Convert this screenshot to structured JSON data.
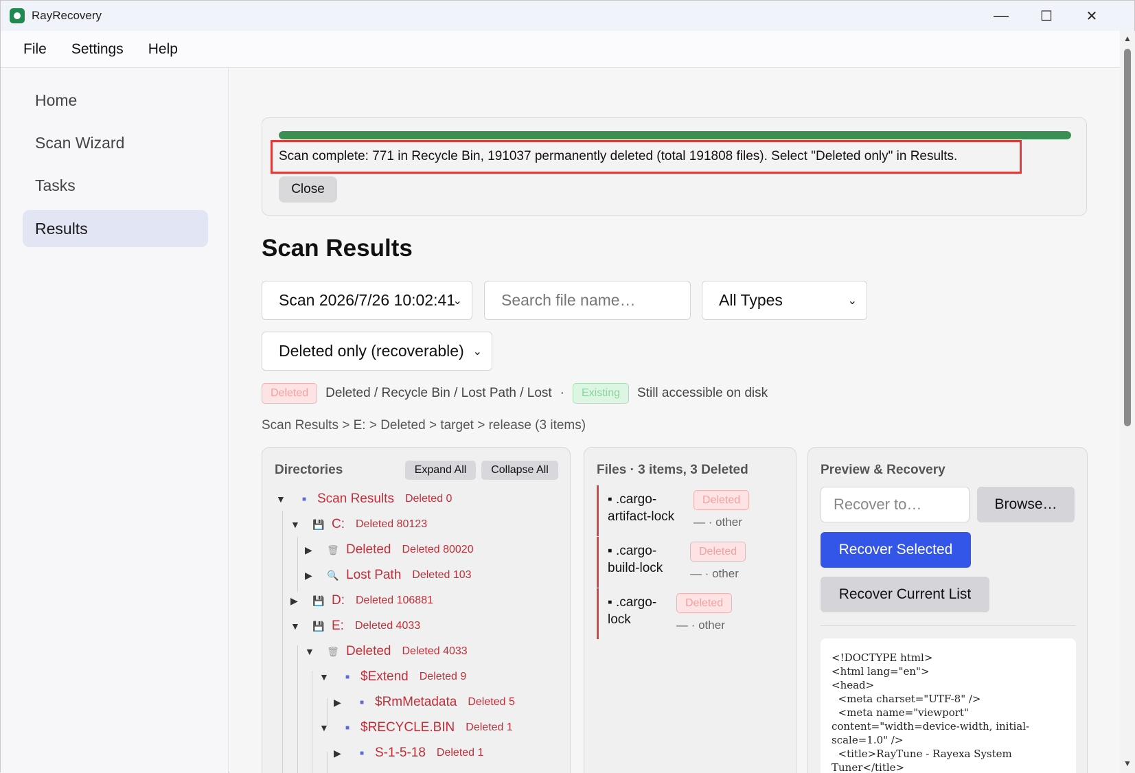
{
  "app": {
    "title": "RayRecovery"
  },
  "window_controls": {
    "minimize": "—",
    "maximize": "☐",
    "close": "✕"
  },
  "menu": [
    "File",
    "Settings",
    "Help"
  ],
  "sidebar": {
    "items": [
      {
        "label": "Home",
        "active": false
      },
      {
        "label": "Scan Wizard",
        "active": false
      },
      {
        "label": "Tasks",
        "active": false
      },
      {
        "label": "Results",
        "active": true
      }
    ]
  },
  "progress": {
    "value_percent": 100,
    "status": "Scan complete: 771 in Recycle Bin, 191037 permanently deleted (total 191808 files). Select \"Deleted only\" in Results.",
    "close_label": "Close"
  },
  "page_title": "Scan Results",
  "filters": {
    "scan_select": "Scan 2026/7/26 10:02:41",
    "search_placeholder": "Search file name…",
    "type_select": "All Types",
    "deleted_select": "Deleted only (recoverable)"
  },
  "legend": {
    "deleted_badge": "Deleted",
    "deleted_desc": "Deleted / Recycle Bin / Lost Path / Lost",
    "separator": "·",
    "existing_badge": "Existing",
    "existing_desc": "Still accessible on disk"
  },
  "breadcrumb": "Scan Results > E: > Deleted > target > release  (3 items)",
  "directories": {
    "title": "Directories",
    "expand_all": "Expand All",
    "collapse_all": "Collapse All",
    "tree": [
      {
        "twisty": "▼",
        "icon": "dot",
        "name": "Scan Results",
        "count": "Deleted 0"
      },
      {
        "twisty": "▼",
        "icon": "drive",
        "name": "C:",
        "count": "Deleted 80123"
      },
      {
        "twisty": "▶",
        "icon": "bin",
        "name": "Deleted",
        "count": "Deleted 80020"
      },
      {
        "twisty": "▶",
        "icon": "lens",
        "name": "Lost Path",
        "count": "Deleted 103"
      },
      {
        "twisty": "▶",
        "icon": "drive",
        "name": "D:",
        "count": "Deleted 106881"
      },
      {
        "twisty": "▼",
        "icon": "drive",
        "name": "E:",
        "count": "Deleted 4033"
      },
      {
        "twisty": "▼",
        "icon": "bin",
        "name": "Deleted",
        "count": "Deleted 4033"
      },
      {
        "twisty": "▼",
        "icon": "dot",
        "name": "$Extend",
        "count": "Deleted 9"
      },
      {
        "twisty": "▶",
        "icon": "dot",
        "name": "$RmMetadata",
        "count": "Deleted 5"
      },
      {
        "twisty": "▼",
        "icon": "dot",
        "name": "$RECYCLE.BIN",
        "count": "Deleted 1"
      },
      {
        "twisty": "▶",
        "icon": "dot",
        "name": "S-1-5-18",
        "count": "Deleted 1"
      }
    ]
  },
  "files": {
    "title": "Files · 3 items, 3 Deleted",
    "items": [
      {
        "line1": "▪ .cargo-",
        "line2": "artifact-lock",
        "badge": "Deleted",
        "meta": "— · other"
      },
      {
        "line1": "▪ .cargo-",
        "line2": "build-lock",
        "badge": "Deleted",
        "meta": "— · other"
      },
      {
        "line1": "▪ .cargo-",
        "line2": "lock",
        "badge": "Deleted",
        "meta": "— · other"
      }
    ]
  },
  "preview": {
    "title": "Preview & Recovery",
    "recover_to_placeholder": "Recover to…",
    "browse_label": "Browse…",
    "recover_selected_label": "Recover Selected",
    "recover_list_label": "Recover Current List",
    "code": "<!DOCTYPE html>\n<html lang=\"en\">\n<head>\n  <meta charset=\"UTF-8\" />\n  <meta name=\"viewport\"\ncontent=\"width=device-width, initial-\nscale=1.0\" />\n  <title>RayTune - Rayexa System\nTuner</title>"
  },
  "colors": {
    "accent": "#3355e8",
    "progress": "#3c8f52",
    "deleted": "#c0303a",
    "highlight": "#e03a3a"
  }
}
